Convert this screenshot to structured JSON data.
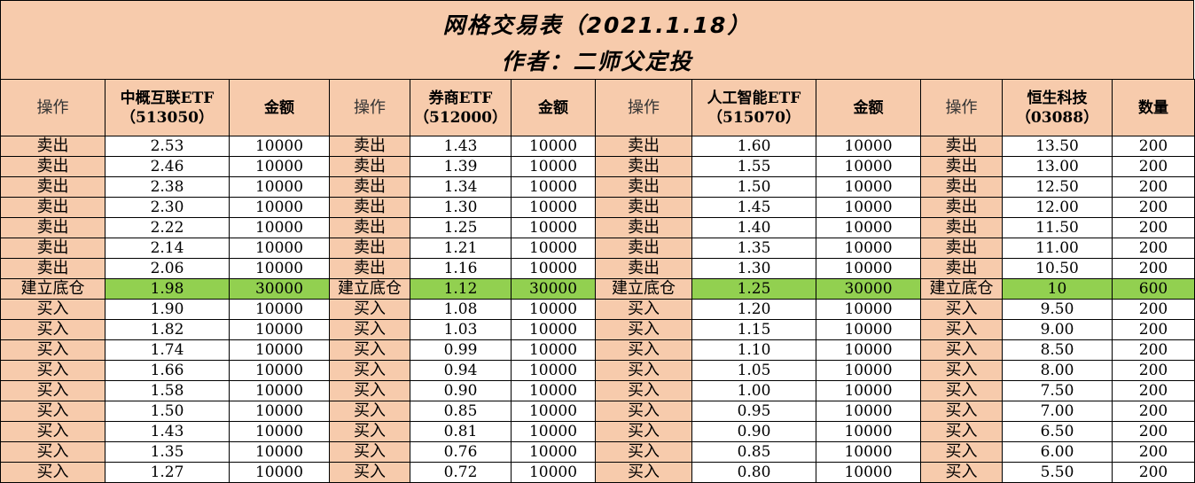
{
  "title": "网格交易表（2021.1.18）",
  "subtitle": "作者：二师父定投",
  "headers": [
    {
      "text": "操作",
      "kind": "op"
    },
    {
      "text": "中概互联ETF\n（513050）",
      "kind": "strong"
    },
    {
      "text": "金额",
      "kind": "strong"
    },
    {
      "text": "操作",
      "kind": "op"
    },
    {
      "text": "券商ETF\n（512000）",
      "kind": "strong"
    },
    {
      "text": "金额",
      "kind": "strong"
    },
    {
      "text": "操作",
      "kind": "op"
    },
    {
      "text": "人工智能ETF\n（515070）",
      "kind": "strong"
    },
    {
      "text": "金额",
      "kind": "strong"
    },
    {
      "text": "操作",
      "kind": "op"
    },
    {
      "text": "恒生科技\n（03088）",
      "kind": "strong"
    },
    {
      "text": "数量",
      "kind": "strong"
    }
  ],
  "rows": [
    {
      "type": "sell",
      "cells": [
        "卖出",
        "2.53",
        "10000",
        "卖出",
        "1.43",
        "10000",
        "卖出",
        "1.60",
        "10000",
        "卖出",
        "13.50",
        "200"
      ]
    },
    {
      "type": "sell",
      "cells": [
        "卖出",
        "2.46",
        "10000",
        "卖出",
        "1.39",
        "10000",
        "卖出",
        "1.55",
        "10000",
        "卖出",
        "13.00",
        "200"
      ]
    },
    {
      "type": "sell",
      "cells": [
        "卖出",
        "2.38",
        "10000",
        "卖出",
        "1.34",
        "10000",
        "卖出",
        "1.50",
        "10000",
        "卖出",
        "12.50",
        "200"
      ]
    },
    {
      "type": "sell",
      "cells": [
        "卖出",
        "2.30",
        "10000",
        "卖出",
        "1.30",
        "10000",
        "卖出",
        "1.45",
        "10000",
        "卖出",
        "12.00",
        "200"
      ]
    },
    {
      "type": "sell",
      "cells": [
        "卖出",
        "2.22",
        "10000",
        "卖出",
        "1.25",
        "10000",
        "卖出",
        "1.40",
        "10000",
        "卖出",
        "11.50",
        "200"
      ]
    },
    {
      "type": "sell",
      "cells": [
        "卖出",
        "2.14",
        "10000",
        "卖出",
        "1.21",
        "10000",
        "卖出",
        "1.35",
        "10000",
        "卖出",
        "11.00",
        "200"
      ]
    },
    {
      "type": "sell",
      "cells": [
        "卖出",
        "2.06",
        "10000",
        "卖出",
        "1.16",
        "10000",
        "卖出",
        "1.30",
        "10000",
        "卖出",
        "10.50",
        "200"
      ]
    },
    {
      "type": "base",
      "cells": [
        "建立底仓",
        "1.98",
        "30000",
        "建立底仓",
        "1.12",
        "30000",
        "建立底仓",
        "1.25",
        "30000",
        "建立底仓",
        "10",
        "600"
      ]
    },
    {
      "type": "buy",
      "cells": [
        "买入",
        "1.90",
        "10000",
        "买入",
        "1.08",
        "10000",
        "买入",
        "1.20",
        "10000",
        "买入",
        "9.50",
        "200"
      ]
    },
    {
      "type": "buy",
      "cells": [
        "买入",
        "1.82",
        "10000",
        "买入",
        "1.03",
        "10000",
        "买入",
        "1.15",
        "10000",
        "买入",
        "9.00",
        "200"
      ]
    },
    {
      "type": "buy",
      "cells": [
        "买入",
        "1.74",
        "10000",
        "买入",
        "0.99",
        "10000",
        "买入",
        "1.10",
        "10000",
        "买入",
        "8.50",
        "200"
      ]
    },
    {
      "type": "buy",
      "cells": [
        "买入",
        "1.66",
        "10000",
        "买入",
        "0.94",
        "10000",
        "买入",
        "1.05",
        "10000",
        "买入",
        "8.00",
        "200"
      ]
    },
    {
      "type": "buy",
      "cells": [
        "买入",
        "1.58",
        "10000",
        "买入",
        "0.90",
        "10000",
        "买入",
        "1.00",
        "10000",
        "买入",
        "7.50",
        "200"
      ]
    },
    {
      "type": "buy",
      "cells": [
        "买入",
        "1.50",
        "10000",
        "买入",
        "0.85",
        "10000",
        "买入",
        "0.95",
        "10000",
        "买入",
        "7.00",
        "200"
      ]
    },
    {
      "type": "buy",
      "cells": [
        "买入",
        "1.43",
        "10000",
        "买入",
        "0.81",
        "10000",
        "买入",
        "0.90",
        "10000",
        "买入",
        "6.50",
        "200"
      ]
    },
    {
      "type": "buy",
      "cells": [
        "买入",
        "1.35",
        "10000",
        "买入",
        "0.76",
        "10000",
        "买入",
        "0.85",
        "10000",
        "买入",
        "6.00",
        "200"
      ]
    },
    {
      "type": "buy",
      "cells": [
        "买入",
        "1.27",
        "10000",
        "买入",
        "0.72",
        "10000",
        "买入",
        "0.80",
        "10000",
        "买入",
        "5.50",
        "200"
      ]
    }
  ],
  "colors": {
    "header_bg": "#f7cbac",
    "base_row_bg": "#92d050",
    "cell_bg": "#ffffff"
  }
}
